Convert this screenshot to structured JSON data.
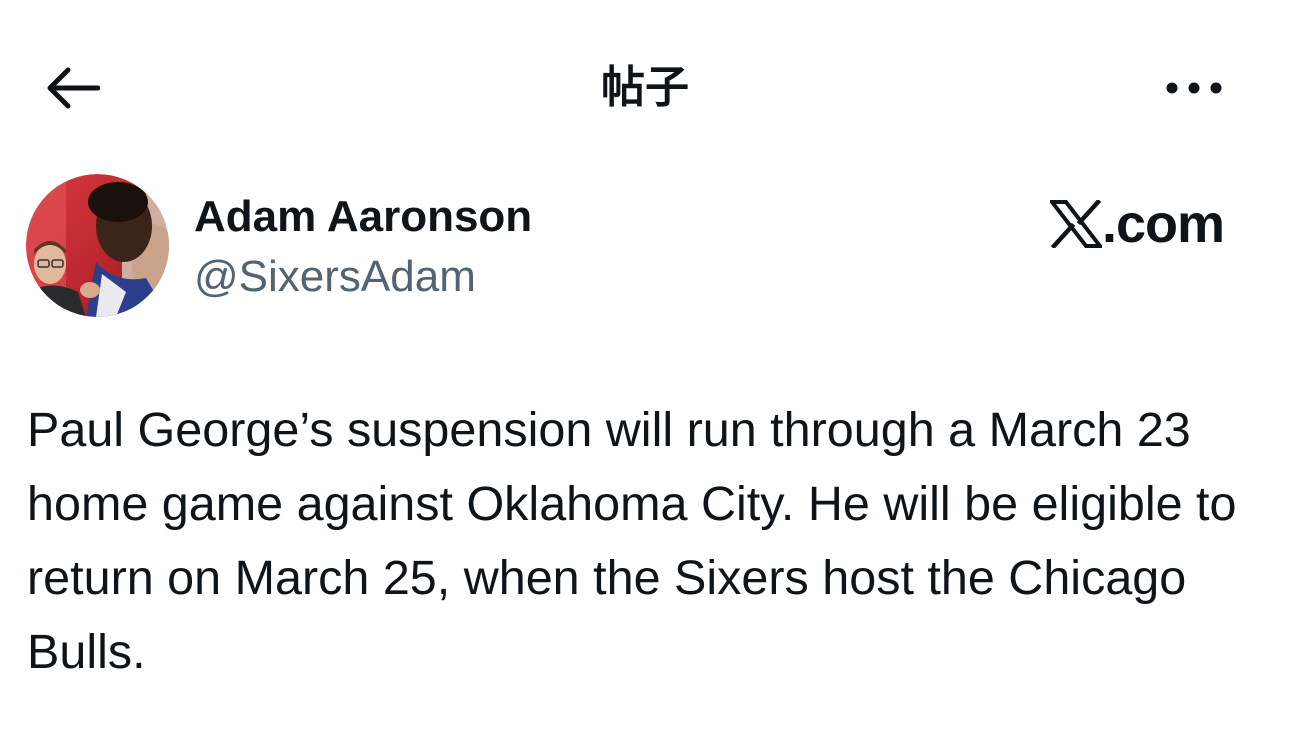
{
  "header": {
    "title": "帖子",
    "back_icon": "arrow-left-icon",
    "more_icon": "more-horizontal-icon"
  },
  "author": {
    "name": "Adam Aaronson",
    "handle": "@SixersAdam",
    "avatar": "avatar-photo"
  },
  "brand": {
    "label": ".com",
    "logo_icon": "x-logo-icon"
  },
  "post": {
    "text": "Paul George’s suspension will run through a March 23 home game against Oklahoma City. He will be eligible to return on March 25, when the Sixers host the Chicago Bulls."
  },
  "colors": {
    "text_primary": "#0f1419",
    "text_secondary": "#536471",
    "background": "#ffffff"
  }
}
